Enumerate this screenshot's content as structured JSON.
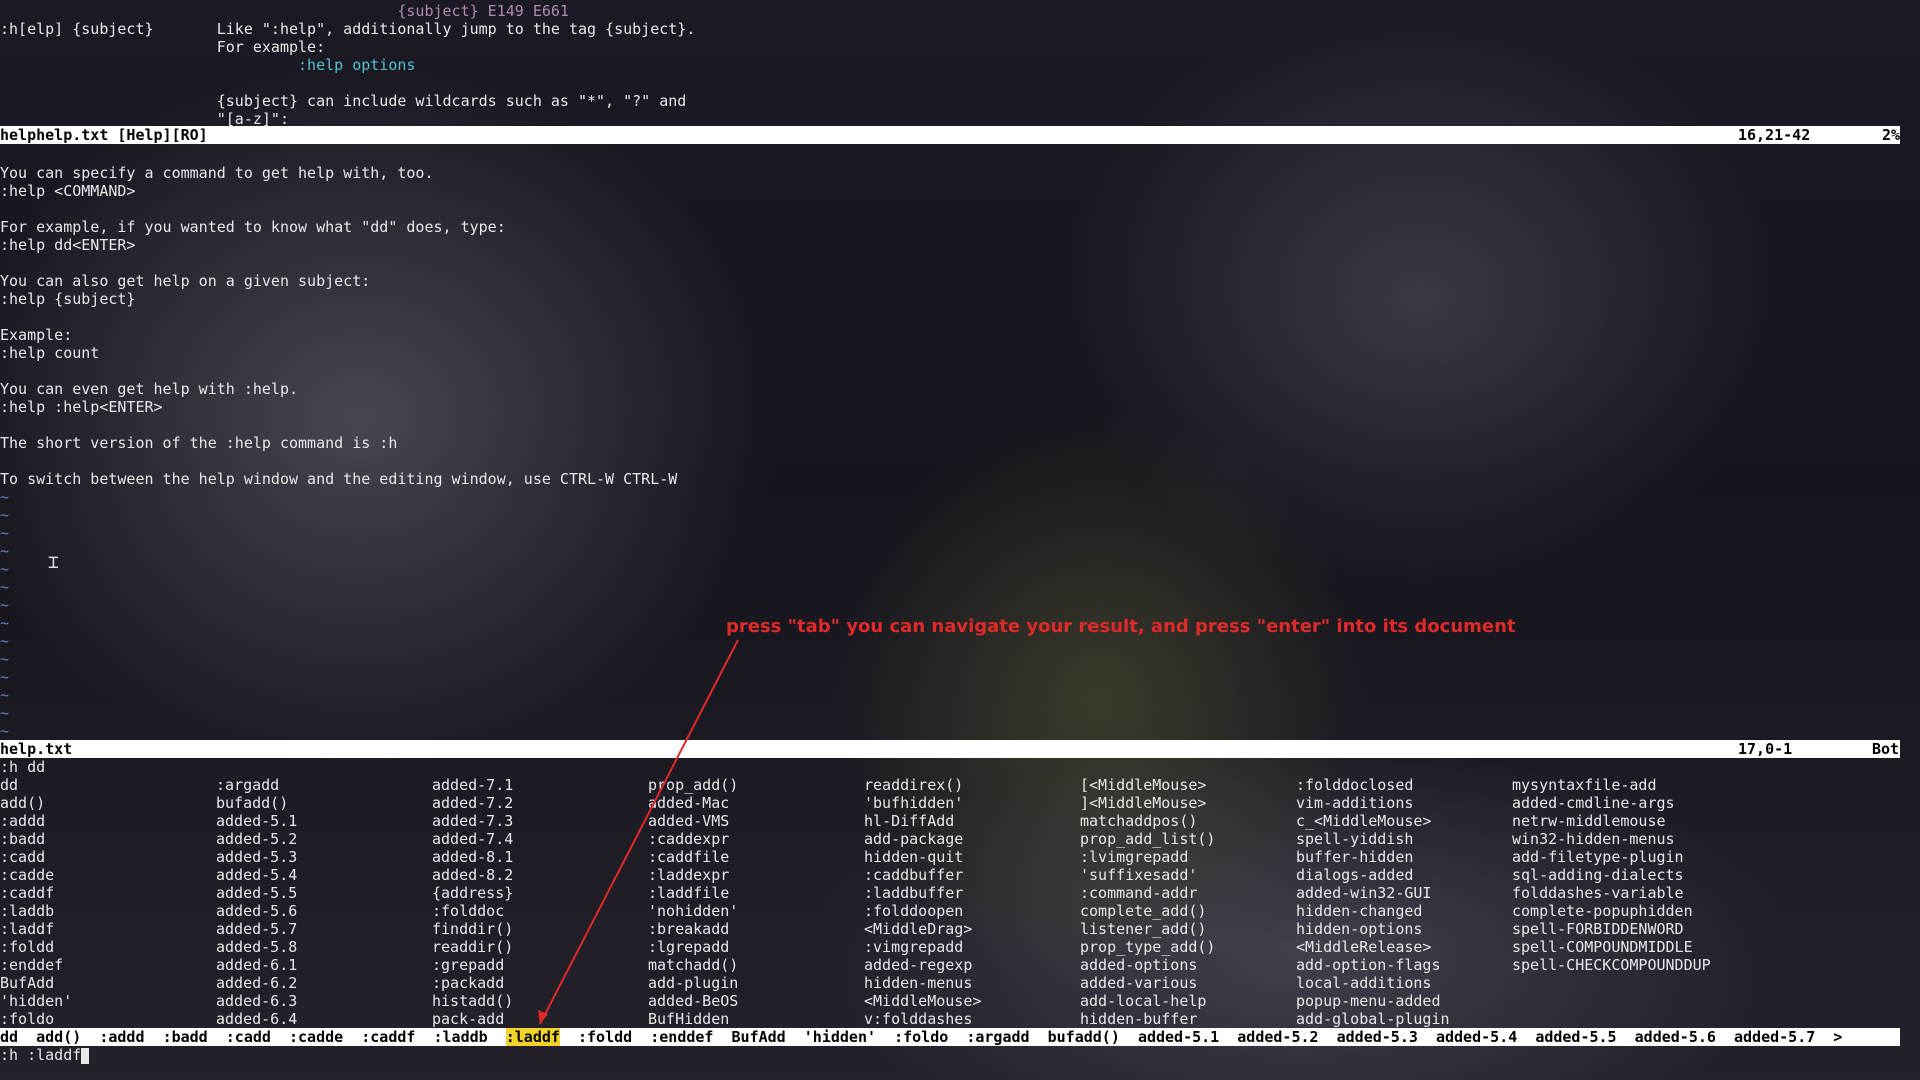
{
  "top_window": {
    "lines": [
      {
        "segments": [
          {
            "text": "                                            {subject} E149 E661",
            "cls": "hl-faint"
          }
        ]
      },
      {
        "segments": [
          {
            "text": ":h[elp] {subject}       Like \":help\", additionally jump to the tag {subject}."
          }
        ]
      },
      {
        "segments": [
          {
            "text": "                        For example:"
          }
        ]
      },
      {
        "segments": [
          {
            "text": "                                 "
          },
          {
            "text": ":help options",
            "cls": "hl-link"
          }
        ]
      },
      {
        "segments": [
          {
            "text": ""
          }
        ]
      },
      {
        "segments": [
          {
            "text": "                        {subject} can include wildcards such as \"*\", \"?\" and"
          }
        ]
      },
      {
        "segments": [
          {
            "text": "                        \"[a-z]\":"
          }
        ]
      }
    ],
    "status": {
      "name": "helphelp.txt [Help][RO]",
      "position": "16,21-42",
      "percent": "2%"
    }
  },
  "middle_window": {
    "lines": [
      "You can specify a command to get help with, too.",
      ":help <COMMAND>",
      "",
      "For example, if you wanted to know what \"dd\" does, type:",
      ":help dd<ENTER>",
      "",
      "You can also get help on a given subject:",
      ":help {subject}",
      "",
      "Example:",
      ":help count",
      "",
      "You can even get help with :help.",
      ":help :help<ENTER>",
      "",
      "The short version of the :help command is :h",
      "",
      "To switch between the help window and the editing window, use CTRL-W CTRL-W"
    ],
    "tilde_count": 14,
    "tilde_char": "~",
    "status": {
      "name": "help.txt",
      "position": "17,0-1",
      "percent": "Bot"
    }
  },
  "command_echo": ":h dd",
  "completion_grid": [
    [
      "dd",
      "add()",
      ":addd",
      ":badd",
      ":cadd",
      ":cadde",
      ":caddf",
      ":laddb",
      ":laddf",
      ":foldd",
      ":enddef",
      "BufAdd",
      "'hidden'",
      ":foldo"
    ],
    [
      ":argadd",
      "bufadd()",
      "added-5.1",
      "added-5.2",
      "added-5.3",
      "added-5.4",
      "added-5.5",
      "added-5.6",
      "added-5.7",
      "added-5.8",
      "added-6.1",
      "added-6.2",
      "added-6.3",
      "added-6.4"
    ],
    [
      "added-7.1",
      "added-7.2",
      "added-7.3",
      "added-7.4",
      "added-8.1",
      "added-8.2",
      "{address}",
      ":folddoc",
      "finddir()",
      "readdir()",
      ":grepadd",
      ":packadd",
      "histadd()",
      "pack-add"
    ],
    [
      "prop_add()",
      "added-Mac",
      "added-VMS",
      ":caddexpr",
      ":caddfile",
      ":laddexpr",
      ":laddfile",
      "'nohidden'",
      ":breakadd",
      ":lgrepadd",
      "matchadd()",
      "add-plugin",
      "added-BeOS",
      "BufHidden"
    ],
    [
      "readdirex()",
      "'bufhidden'",
      "hl-DiffAdd",
      "add-package",
      "hidden-quit",
      ":caddbuffer",
      ":laddbuffer",
      ":folddoopen",
      "<MiddleDrag>",
      ":vimgrepadd",
      "added-regexp",
      "hidden-menus",
      "<MiddleMouse>",
      "v:folddashes"
    ],
    [
      "[<MiddleMouse>",
      "]<MiddleMouse>",
      "matchaddpos()",
      "prop_add_list()",
      ":lvimgrepadd",
      "'suffixesadd'",
      ":command-addr",
      "complete_add()",
      "listener_add()",
      "prop_type_add()",
      "added-options",
      "added-various",
      "add-local-help",
      "hidden-buffer"
    ],
    [
      ":folddoclosed",
      "vim-additions",
      "c_<MiddleMouse>",
      "spell-yiddish",
      "buffer-hidden",
      "dialogs-added",
      "added-win32-GUI",
      "hidden-changed",
      "hidden-options",
      "<MiddleRelease>",
      "add-option-flags",
      "local-additions",
      "popup-menu-added",
      "add-global-plugin"
    ],
    [
      "mysyntaxfile-add",
      "added-cmdline-args",
      "netrw-middlemouse",
      "win32-hidden-menus",
      "add-filetype-plugin",
      "sql-adding-dialects",
      "folddashes-variable",
      "complete-popuphidden",
      "spell-FORBIDDENWORD",
      "spell-COMPOUNDMIDDLE",
      "spell-CHECKCOMPOUNDDUP"
    ]
  ],
  "wildmenu": {
    "items": [
      "dd",
      "add()",
      ":addd",
      ":badd",
      ":cadd",
      ":cadde",
      ":caddf",
      ":laddb",
      ":laddf",
      ":foldd",
      ":enddef",
      "BufAdd",
      "'hidden'",
      ":foldo",
      ":argadd",
      "bufadd()",
      "added-5.1",
      "added-5.2",
      "added-5.3",
      "added-5.4",
      "added-5.5",
      "added-5.6",
      "added-5.7"
    ],
    "selected_index": 8,
    "more_indicator": ">"
  },
  "command_line": ":h :laddf",
  "annotation": "press \"tab\" you can navigate your result, and press \"enter\" into its document",
  "colors": {
    "annotation": "#e02a2a",
    "wild_selected": "#f2d32a",
    "status_bar": "#ffffff",
    "tilde": "#6a7ad0",
    "link": "#4fc3d0"
  }
}
